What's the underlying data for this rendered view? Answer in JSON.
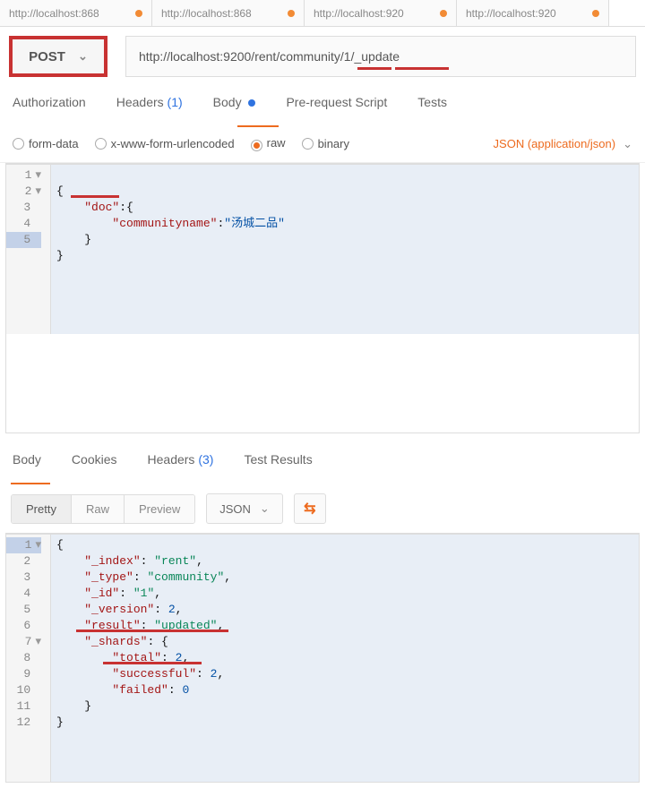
{
  "tabs": [
    {
      "label": "http://localhost:868"
    },
    {
      "label": "http://localhost:868"
    },
    {
      "label": "http://localhost:920"
    },
    {
      "label": "http://localhost:920"
    }
  ],
  "method": "POST",
  "url": "http://localhost:9200/rent/community/1/_update",
  "reqTabs": {
    "auth": "Authorization",
    "headers": "Headers",
    "headersCount": "(1)",
    "body": "Body",
    "preReq": "Pre-request Script",
    "tests": "Tests"
  },
  "bodyOpts": {
    "formData": "form-data",
    "urlenc": "x-www-form-urlencoded",
    "raw": "raw",
    "binary": "binary",
    "ct": "JSON (application/json)"
  },
  "reqCode": {
    "lines": [
      "1",
      "2",
      "3",
      "4",
      "5"
    ],
    "l1": "{",
    "l2a": "    ",
    "l2b": "\"doc\"",
    "l2c": ":{",
    "l3a": "        ",
    "l3b": "\"communityname\"",
    "l3c": ":",
    "l3d": "\"汤城二品\"",
    "l4": "    }",
    "l5": "}"
  },
  "respTabs": {
    "body": "Body",
    "cookies": "Cookies",
    "headers": "Headers",
    "headersCount": "(3)",
    "testResults": "Test Results"
  },
  "respTools": {
    "pretty": "Pretty",
    "raw": "Raw",
    "preview": "Preview",
    "lang": "JSON"
  },
  "respCode": {
    "lines": [
      "1",
      "2",
      "3",
      "4",
      "5",
      "6",
      "7",
      "8",
      "9",
      "10",
      "11",
      "12"
    ],
    "l1": "{",
    "l2a": "\"_index\"",
    "l2b": "\"rent\"",
    "l3a": "\"_type\"",
    "l3b": "\"community\"",
    "l4a": "\"_id\"",
    "l4b": "\"1\"",
    "l5a": "\"_version\"",
    "l5b": "2",
    "l6a": "\"result\"",
    "l6b": "\"updated\"",
    "l7a": "\"_shards\"",
    "l8a": "\"total\"",
    "l8b": "2",
    "l9a": "\"successful\"",
    "l9b": "2",
    "l10a": "\"failed\"",
    "l10b": "0",
    "l11": "    }",
    "l12": "}"
  },
  "icons": {
    "wrap": "⇆"
  }
}
